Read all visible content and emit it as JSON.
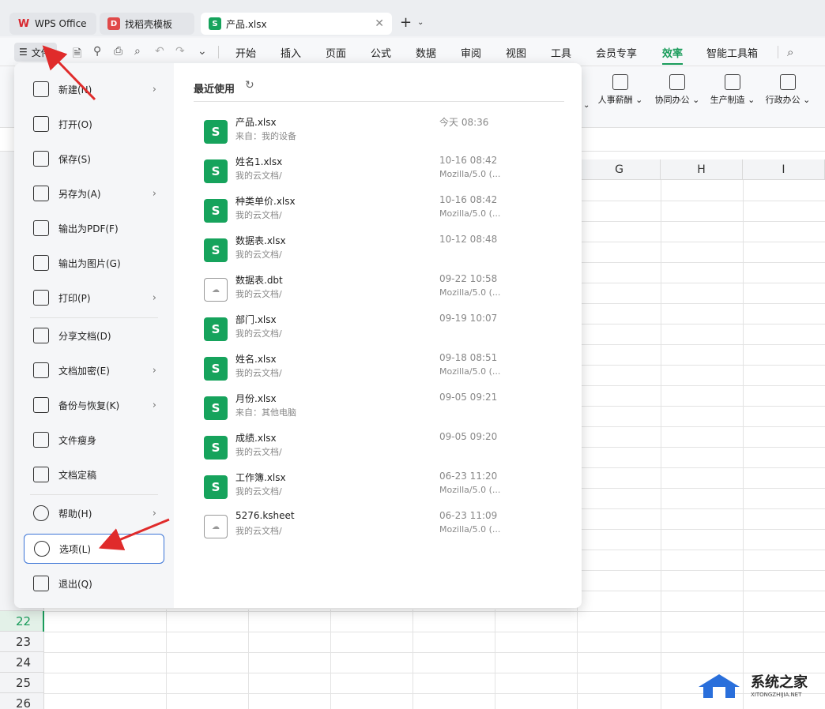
{
  "tabs": [
    {
      "label": "WPS Office",
      "icon": "wps-logo-icon",
      "color": "#d9282f"
    },
    {
      "label": "找稻壳模板",
      "icon": "docer-logo-icon",
      "color": "#e04a4a"
    },
    {
      "label": "产品.xlsx",
      "icon": "spreadsheet-icon",
      "color": "#16a35c",
      "active": true
    }
  ],
  "menubar": {
    "file_label": "文件",
    "items": [
      "开始",
      "插入",
      "页面",
      "公式",
      "数据",
      "审阅",
      "视图",
      "工具",
      "会员专享",
      "效率",
      "智能工具箱"
    ],
    "active": "效率"
  },
  "ribbon": {
    "buttons": [
      "人事薪酬",
      "协同办公",
      "生产制造",
      "行政办公"
    ]
  },
  "sheet": {
    "columns": [
      "G",
      "H",
      "I"
    ],
    "rows": [
      "22",
      "23",
      "24",
      "25",
      "26"
    ],
    "selected_row": "22"
  },
  "file_menu": {
    "items": [
      {
        "label": "新建(N)",
        "icon": "new-file-icon",
        "arrow": true
      },
      {
        "label": "打开(O)",
        "icon": "open-folder-icon",
        "arrow": false
      },
      {
        "label": "保存(S)",
        "icon": "save-icon",
        "arrow": false
      },
      {
        "label": "另存为(A)",
        "icon": "save-as-icon",
        "arrow": true
      },
      {
        "label": "输出为PDF(F)",
        "icon": "export-pdf-icon",
        "arrow": false
      },
      {
        "label": "输出为图片(G)",
        "icon": "export-image-icon",
        "arrow": false
      },
      {
        "label": "打印(P)",
        "icon": "print-icon",
        "arrow": true
      },
      {
        "label": "分享文档(D)",
        "icon": "share-icon",
        "arrow": false
      },
      {
        "label": "文档加密(E)",
        "icon": "encrypt-icon",
        "arrow": true
      },
      {
        "label": "备份与恢复(K)",
        "icon": "backup-icon",
        "arrow": true
      },
      {
        "label": "文件瘦身",
        "icon": "slim-icon",
        "arrow": false
      },
      {
        "label": "文档定稿",
        "icon": "finalize-icon",
        "arrow": false
      },
      {
        "label": "帮助(H)",
        "icon": "help-icon",
        "arrow": true
      },
      {
        "label": "选项(L)",
        "icon": "options-gear-icon",
        "arrow": false,
        "highlighted": true
      },
      {
        "label": "退出(Q)",
        "icon": "exit-icon",
        "arrow": false
      }
    ]
  },
  "recent": {
    "title": "最近使用",
    "files": [
      {
        "name": "产品.xlsx",
        "source": "来自：我的设备",
        "time": "今天  08:36",
        "device": "",
        "type": "S"
      },
      {
        "name": "姓名1.xlsx",
        "source": "我的云文档/",
        "time": "10-16 08:42",
        "device": "Mozilla/5.0 (...",
        "type": "S"
      },
      {
        "name": "种类单价.xlsx",
        "source": "我的云文档/",
        "time": "10-16 08:42",
        "device": "Mozilla/5.0 (...",
        "type": "S"
      },
      {
        "name": "数据表.xlsx",
        "source": "我的云文档/",
        "time": "10-12 08:48",
        "device": "",
        "type": "S"
      },
      {
        "name": "数据表.dbt",
        "source": "我的云文档/",
        "time": "09-22 10:58",
        "device": "Mozilla/5.0 (...",
        "type": "doc"
      },
      {
        "name": "部门.xlsx",
        "source": "我的云文档/",
        "time": "09-19 10:07",
        "device": "",
        "type": "S"
      },
      {
        "name": "姓名.xlsx",
        "source": "我的云文档/",
        "time": "09-18 08:51",
        "device": "Mozilla/5.0 (...",
        "type": "S"
      },
      {
        "name": "月份.xlsx",
        "source": "来自：其他电脑",
        "time": "09-05 09:21",
        "device": "",
        "type": "S"
      },
      {
        "name": "成绩.xlsx",
        "source": "我的云文档/",
        "time": "09-05 09:20",
        "device": "",
        "type": "S"
      },
      {
        "name": "工作簿.xlsx",
        "source": "我的云文档/",
        "time": "06-23 11:20",
        "device": "Mozilla/5.0 (...",
        "type": "S"
      },
      {
        "name": "5276.ksheet",
        "source": "我的云文档/",
        "time": "06-23 11:09",
        "device": "Mozilla/5.0 (...",
        "type": "doc"
      }
    ]
  },
  "watermark": {
    "text": "系统之家",
    "sub": "XITONGZHIJIA.NET"
  },
  "colors": {
    "accent": "#1a9c5b",
    "highlight_border": "#3b74d6",
    "arrow": "#e02b2b"
  }
}
